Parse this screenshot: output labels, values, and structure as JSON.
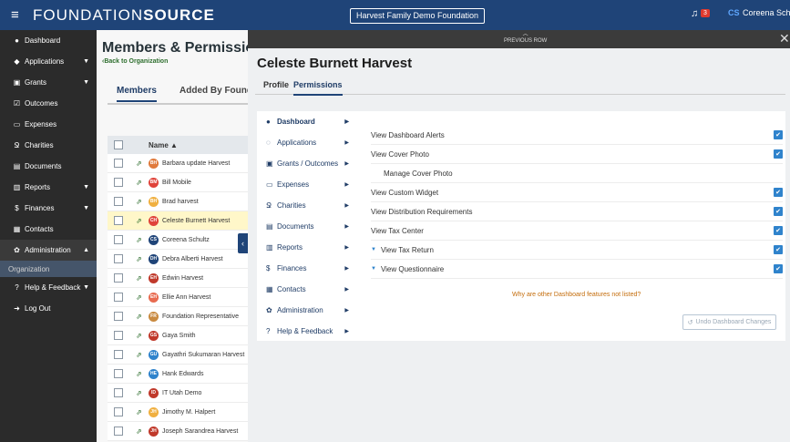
{
  "app": {
    "logo_light": "FOUNDATION",
    "logo_bold": "SOURCE",
    "foundation_name": "Harvest Family Demo Foundation",
    "notifications_count": "3",
    "user_initials": "CS",
    "user_name": "Coreena Schultz"
  },
  "sidebar": {
    "items": [
      {
        "label": "Dashboard",
        "icon": "palette-icon",
        "glyph": "●"
      },
      {
        "label": "Applications",
        "icon": "chat-icon",
        "glyph": "◆"
      },
      {
        "label": "Grants",
        "icon": "gift-icon",
        "glyph": "▣"
      },
      {
        "label": "Outcomes",
        "icon": "checkbox-icon",
        "glyph": "☑"
      },
      {
        "label": "Expenses",
        "icon": "money-icon",
        "glyph": "▭"
      },
      {
        "label": "Charities",
        "icon": "ribbon-icon",
        "glyph": "Ջ"
      },
      {
        "label": "Documents",
        "icon": "document-icon",
        "glyph": "▤"
      },
      {
        "label": "Reports",
        "icon": "bar-chart-icon",
        "glyph": "▥"
      },
      {
        "label": "Finances",
        "icon": "dollar-icon",
        "glyph": "$"
      },
      {
        "label": "Contacts",
        "icon": "contact-icon",
        "glyph": "▦"
      },
      {
        "label": "Administration",
        "icon": "gear-icon",
        "glyph": "✿"
      },
      {
        "label": "Help & Feedback",
        "icon": "question-icon",
        "glyph": "?"
      },
      {
        "label": "Log Out",
        "icon": "logout-icon",
        "glyph": "➜"
      }
    ],
    "sub_item": "Organization"
  },
  "members_page": {
    "title": "Members & Permissions",
    "back_link": "‹Back to Organization",
    "tab_members": "Members",
    "tab_added_by": "Added By Foundat",
    "column_name": "Name ▲",
    "rows": [
      {
        "initials": "BH",
        "name": "Barbara update Harvest",
        "color": "#e07a3c"
      },
      {
        "initials": "BM",
        "name": "Bill Mobile",
        "color": "#e0433a"
      },
      {
        "initials": "BH",
        "name": "Brad harvest",
        "color": "#f0b040"
      },
      {
        "initials": "CH",
        "name": "Celeste Burnett Harvest",
        "color": "#e0433a"
      },
      {
        "initials": "CS",
        "name": "Coreena Schultz",
        "color": "#1f4478"
      },
      {
        "initials": "DH",
        "name": "Debra Alberti Harvest",
        "color": "#1f4478"
      },
      {
        "initials": "EH",
        "name": "Edwin Harvest",
        "color": "#c0392b"
      },
      {
        "initials": "EH",
        "name": "Ellie Ann Harvest",
        "color": "#e86b50"
      },
      {
        "initials": "FR",
        "name": "Foundation Representative",
        "color": "#c98a40"
      },
      {
        "initials": "GS",
        "name": "Gaya Smith",
        "color": "#c0392b"
      },
      {
        "initials": "GU",
        "name": "Gayathri Sukumaran Harvest",
        "color": "#2f83cc"
      },
      {
        "initials": "HE",
        "name": "Hank Edwards",
        "color": "#2f83cc"
      },
      {
        "initials": "ID",
        "name": "IT Utah Demo",
        "color": "#c0392b"
      },
      {
        "initials": "JH",
        "name": "Jimothy M. Halpert",
        "color": "#f0b040"
      },
      {
        "initials": "JH",
        "name": "Joseph Sarandrea Harvest",
        "color": "#c0392b"
      }
    ]
  },
  "panel": {
    "previous_row": "PREVIOUS ROW",
    "person_name": "Celeste Burnett Harvest",
    "tab_profile": "Profile",
    "tab_permissions": "Permissions",
    "categories": [
      {
        "label": "Dashboard",
        "icon": "palette-icon",
        "glyph": "●"
      },
      {
        "label": "Applications",
        "icon": "chat-icon",
        "glyph": "◌"
      },
      {
        "label": "Grants / Outcomes",
        "icon": "gift-icon",
        "glyph": "▣"
      },
      {
        "label": "Expenses",
        "icon": "money-icon",
        "glyph": "▭"
      },
      {
        "label": "Charities",
        "icon": "ribbon-icon",
        "glyph": "Ջ"
      },
      {
        "label": "Documents",
        "icon": "document-icon",
        "glyph": "▤"
      },
      {
        "label": "Reports",
        "icon": "bar-chart-icon",
        "glyph": "▥"
      },
      {
        "label": "Finances",
        "icon": "dollar-icon",
        "glyph": "$"
      },
      {
        "label": "Contacts",
        "icon": "contact-icon",
        "glyph": "▦"
      },
      {
        "label": "Administration",
        "icon": "gear-icon",
        "glyph": "✿"
      },
      {
        "label": "Help & Feedback",
        "icon": "question-icon",
        "glyph": "?"
      }
    ],
    "permissions": [
      "View Dashboard Alerts",
      "View Cover Photo",
      "Manage Cover Photo",
      "View Custom Widget",
      "View Distribution Requirements",
      "View Tax Center",
      "View Tax Return",
      "View Questionnaire"
    ],
    "why_link": "Why are other Dashboard features not listed?",
    "undo_button": "Undo Dashboard Changes"
  },
  "colors": {
    "topbar": "#1f4478",
    "sidebar": "#2b2b2b",
    "checkbox_checked": "#2f83cc",
    "highlight_row": "#fff7c9",
    "link_orange": "#c46d0c"
  }
}
